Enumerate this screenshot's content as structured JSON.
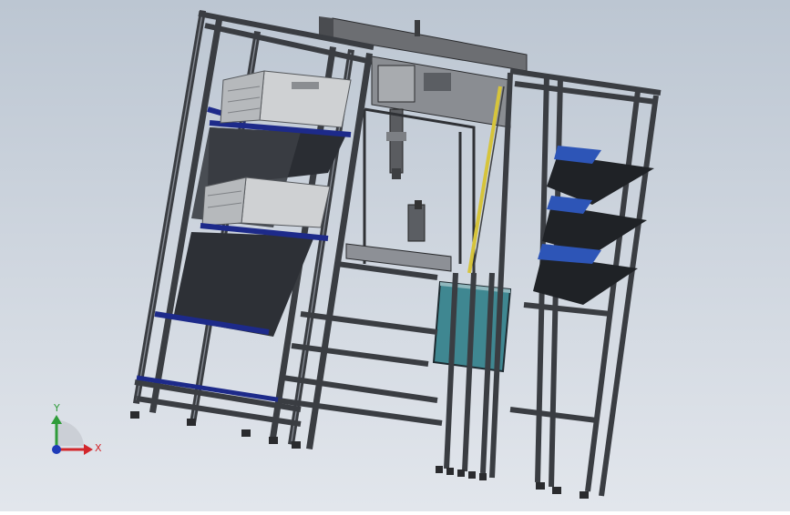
{
  "viewport": {
    "background_top": "#bcc6d2",
    "background_bottom": "#e4e8ee",
    "frame_color": "#3a3d42",
    "frame_highlight": "#8b9099",
    "accent_blue": "#1d2a8a",
    "tray_color": "#2a2d33",
    "crate_color": "#cfd1d3",
    "panel_teal": "#3f8791",
    "tray_blue": "#2d55b7",
    "rail_yellow": "#d6c43b"
  },
  "triad": {
    "x_label": "X",
    "y_label": "Y",
    "x_color": "#d2262b",
    "y_color": "#2f9c3a",
    "z_color": "#1f3bb8"
  }
}
